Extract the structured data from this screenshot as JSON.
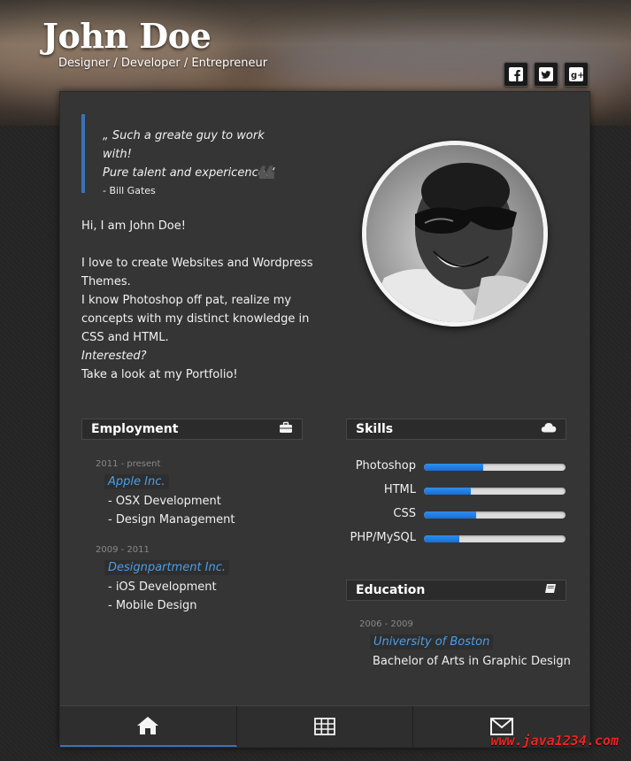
{
  "header": {
    "name": "John Doe",
    "tagline": "Designer / Developer / Entrepreneur",
    "social": [
      {
        "label": "f",
        "icon": "facebook-icon"
      },
      {
        "label": "t",
        "icon": "twitter-icon"
      },
      {
        "label": "g+",
        "icon": "google-plus-icon"
      }
    ]
  },
  "quote": {
    "line1": "„ Such a greate guy to work with!",
    "line2": "Pure talent and expericence.“",
    "author": "- Bill Gates"
  },
  "intro": {
    "greeting": "Hi, I am John Doe!",
    "p1": "I love to create Websites and Wordpress Themes.",
    "p2": "I know Photoshop off pat, realize my concepts with my distinct knowledge in CSS and HTML.",
    "p3": "Interested?",
    "p4": "Take a look at my Portfolio!"
  },
  "employment": {
    "title": "Employment",
    "icon": "briefcase-icon",
    "jobs": [
      {
        "dates": "2011 - present",
        "company": "Apple Inc.",
        "roles": [
          "- OSX Development",
          "- Design Management"
        ]
      },
      {
        "dates": "2009 - 2011",
        "company": "Designpartment Inc.",
        "roles": [
          "- iOS Development",
          "- Mobile Design"
        ]
      }
    ]
  },
  "skills": {
    "title": "Skills",
    "icon": "cloud-icon",
    "items": [
      {
        "name": "Photoshop",
        "level": 0.42
      },
      {
        "name": "HTML",
        "level": 0.33
      },
      {
        "name": "CSS",
        "level": 0.37
      },
      {
        "name": "PHP/MySQL",
        "level": 0.25
      }
    ]
  },
  "education": {
    "title": "Education",
    "icon": "book-icon",
    "entries": [
      {
        "dates": "2006 - 2009",
        "school": "University of Boston",
        "degree": "Bachelor of Arts in Graphic Design"
      }
    ]
  },
  "nav": {
    "tabs": [
      {
        "icon": "home-icon",
        "active": true
      },
      {
        "icon": "grid-icon",
        "active": false
      },
      {
        "icon": "mail-icon",
        "active": false
      }
    ]
  },
  "watermark": "www.java1234.com",
  "colors": {
    "accent": "#3a73b8",
    "link": "#4a9ee8",
    "bar": "#1a6fd0"
  }
}
